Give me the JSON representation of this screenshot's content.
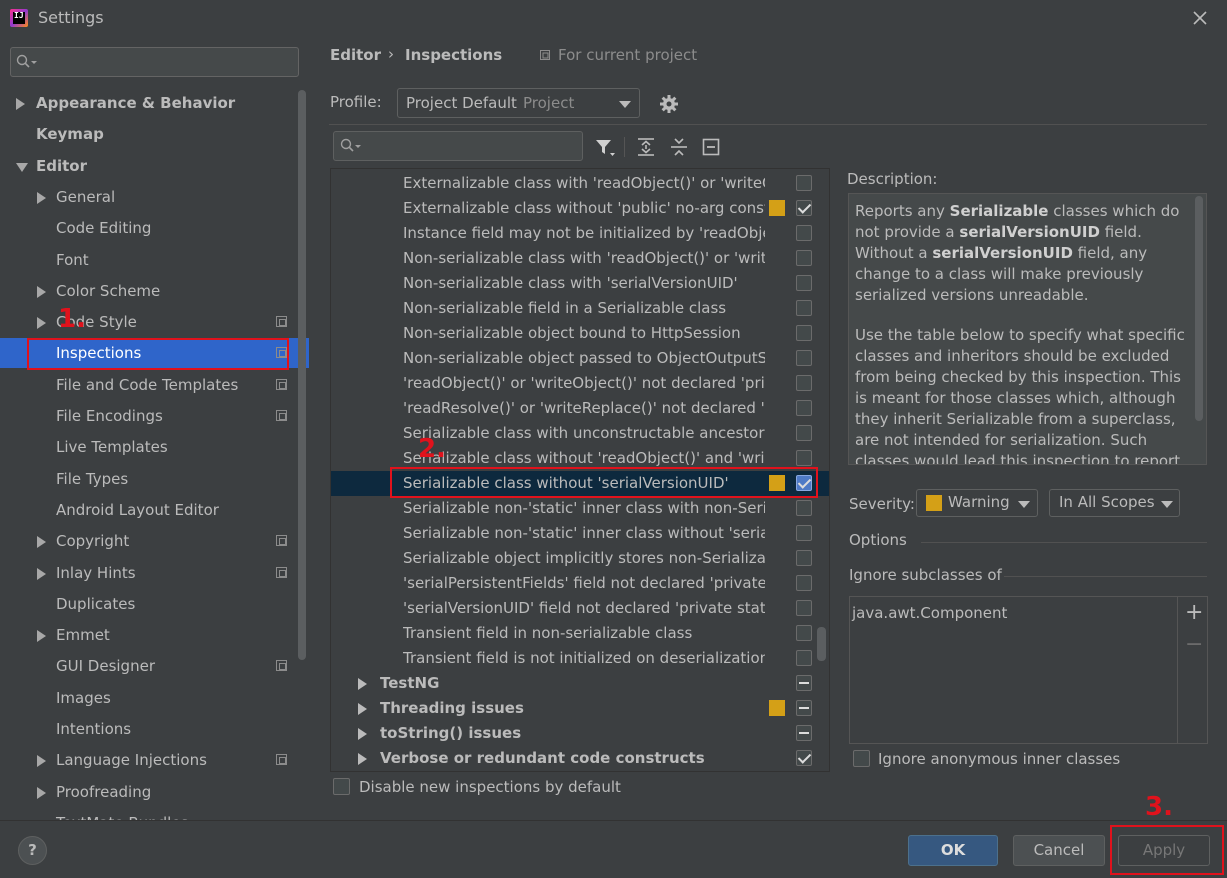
{
  "window": {
    "title": "Settings",
    "app_logo_text": "IJ"
  },
  "sidebar": {
    "items": [
      {
        "label": "Appearance & Behavior",
        "bold": true,
        "arrow": "closed",
        "indent": 0
      },
      {
        "label": "Keymap",
        "bold": true,
        "arrow": "none",
        "indent": 0
      },
      {
        "label": "Editor",
        "bold": true,
        "arrow": "open",
        "indent": 0
      },
      {
        "label": "General",
        "arrow": "closed",
        "indent": 1
      },
      {
        "label": "Code Editing",
        "arrow": "none",
        "indent": 1
      },
      {
        "label": "Font",
        "arrow": "none",
        "indent": 1
      },
      {
        "label": "Color Scheme",
        "arrow": "closed",
        "indent": 1
      },
      {
        "label": "Code Style",
        "arrow": "closed",
        "indent": 1,
        "copy": true
      },
      {
        "label": "Inspections",
        "arrow": "none",
        "indent": 1,
        "copy": true,
        "selected": true
      },
      {
        "label": "File and Code Templates",
        "arrow": "none",
        "indent": 1,
        "copy": true
      },
      {
        "label": "File Encodings",
        "arrow": "none",
        "indent": 1,
        "copy": true
      },
      {
        "label": "Live Templates",
        "arrow": "none",
        "indent": 1
      },
      {
        "label": "File Types",
        "arrow": "none",
        "indent": 1
      },
      {
        "label": "Android Layout Editor",
        "arrow": "none",
        "indent": 1
      },
      {
        "label": "Copyright",
        "arrow": "closed",
        "indent": 1,
        "copy": true
      },
      {
        "label": "Inlay Hints",
        "arrow": "closed",
        "indent": 1,
        "copy": true
      },
      {
        "label": "Duplicates",
        "arrow": "none",
        "indent": 1
      },
      {
        "label": "Emmet",
        "arrow": "closed",
        "indent": 1
      },
      {
        "label": "GUI Designer",
        "arrow": "none",
        "indent": 1,
        "copy": true
      },
      {
        "label": "Images",
        "arrow": "none",
        "indent": 1
      },
      {
        "label": "Intentions",
        "arrow": "none",
        "indent": 1
      },
      {
        "label": "Language Injections",
        "arrow": "closed",
        "indent": 1,
        "copy": true
      },
      {
        "label": "Proofreading",
        "arrow": "closed",
        "indent": 1
      },
      {
        "label": "TextMate Bundles",
        "arrow": "none",
        "indent": 1
      }
    ]
  },
  "breadcrumb": {
    "part1": "Editor",
    "separator": "›",
    "part2": "Inspections",
    "scope_note": "For current project"
  },
  "profile": {
    "label": "Profile:",
    "value": "Project Default",
    "sub": "Project"
  },
  "inspections": [
    {
      "label": "Externalizable class with 'readObject()' or 'writeObject()'",
      "state": "unchecked"
    },
    {
      "label": "Externalizable class without 'public' no-arg constructor",
      "state": "checked",
      "severity": true
    },
    {
      "label": "Instance field may not be initialized by 'readObject()'",
      "state": "unchecked"
    },
    {
      "label": "Non-serializable class with 'readObject()' or 'writeObject()'",
      "state": "unchecked"
    },
    {
      "label": "Non-serializable class with 'serialVersionUID'",
      "state": "unchecked"
    },
    {
      "label": "Non-serializable field in a Serializable class",
      "state": "unchecked"
    },
    {
      "label": "Non-serializable object bound to HttpSession",
      "state": "unchecked"
    },
    {
      "label": "Non-serializable object passed to ObjectOutputStream",
      "state": "unchecked"
    },
    {
      "label": "'readObject()' or 'writeObject()' not declared 'private'",
      "state": "unchecked"
    },
    {
      "label": "'readResolve()' or 'writeReplace()' not declared 'protected'",
      "state": "unchecked"
    },
    {
      "label": "Serializable class with unconstructable ancestor",
      "state": "unchecked"
    },
    {
      "label": "Serializable class without 'readObject()' and 'writeObject()'",
      "state": "unchecked"
    },
    {
      "label": "Serializable class without 'serialVersionUID'",
      "state": "checked",
      "severity": true,
      "selected": true
    },
    {
      "label": "Serializable non-'static' inner class with non-Serializable outer class",
      "state": "unchecked"
    },
    {
      "label": "Serializable non-'static' inner class without 'serialVersionUID'",
      "state": "unchecked"
    },
    {
      "label": "Serializable object implicitly stores non-Serializable object",
      "state": "unchecked"
    },
    {
      "label": "'serialPersistentFields' field not declared 'private static final'",
      "state": "unchecked"
    },
    {
      "label": "'serialVersionUID' field not declared 'private static final long'",
      "state": "unchecked"
    },
    {
      "label": "Transient field in non-serializable class",
      "state": "unchecked"
    },
    {
      "label": "Transient field is not initialized on deserialization",
      "state": "unchecked"
    },
    {
      "label": "TestNG",
      "state": "mixed",
      "group": true
    },
    {
      "label": "Threading issues",
      "state": "mixed",
      "group": true,
      "severity": true
    },
    {
      "label": "toString() issues",
      "state": "mixed",
      "group": true
    },
    {
      "label": "Verbose or redundant code constructs",
      "state": "checked",
      "group": true
    }
  ],
  "disable_new": {
    "label": "Disable new inspections by default"
  },
  "description": {
    "label": "Description:",
    "p1_a": "Reports any ",
    "p1_b": "Serializable",
    "p1_c": " classes which do not provide a ",
    "p1_d": "serialVersionUID",
    "p1_e": " field. Without a ",
    "p1_f": "serialVersionUID",
    "p1_g": " field, any change to a class will make previously serialized versions unreadable.",
    "p2": "Use the table below to specify what specific classes and inheritors should be excluded from being checked by this inspection. This is meant for those classes which, although they inherit Serializable from a superclass, are not intended for serialization. Such classes would lead this inspection to report"
  },
  "severity": {
    "label": "Severity:",
    "value": "Warning",
    "scope": "In All Scopes"
  },
  "options": {
    "label": "Options",
    "ignore_label": "Ignore subclasses of",
    "ignore_item": "java.awt.Component",
    "add": "+",
    "remove": "−",
    "anon_label": "Ignore anonymous inner classes"
  },
  "footer": {
    "help": "?",
    "ok": "OK",
    "cancel": "Cancel",
    "apply": "Apply"
  },
  "annotations": {
    "a1": "1.",
    "a2": "2.",
    "a3": "3."
  },
  "colors": {
    "warning": "#d4a017",
    "selection": "#2f65ca",
    "annotation": "#e0121c"
  }
}
